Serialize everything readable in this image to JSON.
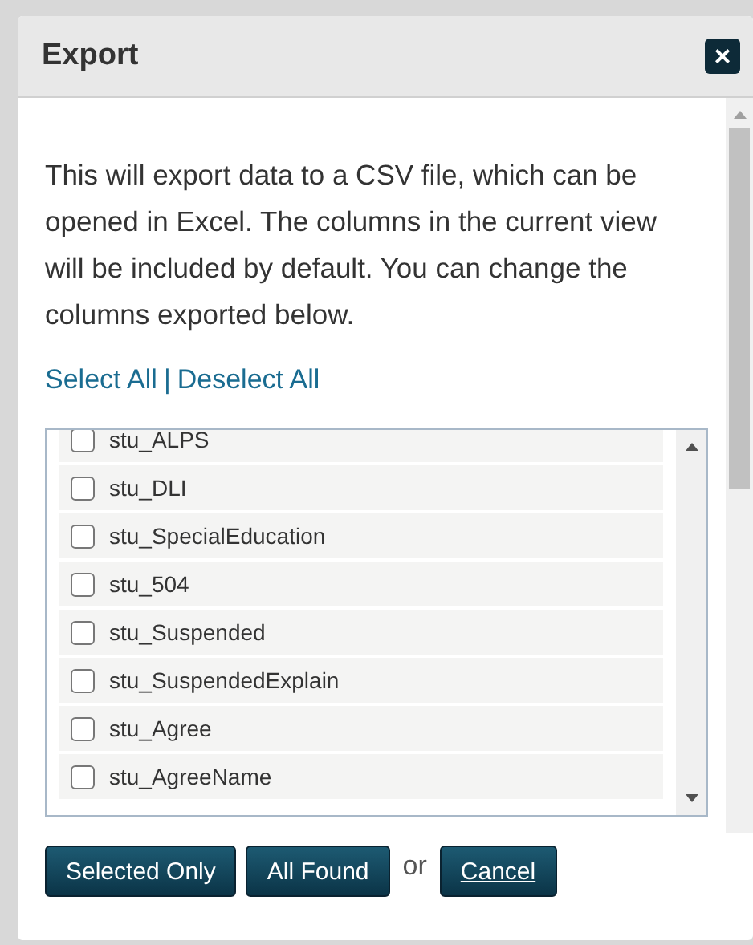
{
  "dialog": {
    "title": "Export",
    "close_label": "×"
  },
  "description": "This will export data to a CSV file, which can be opened in Excel. The columns in the current view will be included by default. You can change the columns exported below.",
  "links": [
    "Select All",
    "Deselect All"
  ],
  "link_separator": "|",
  "columns": [
    {
      "name": "stu_ALPS",
      "checked": false
    },
    {
      "name": "stu_DLI",
      "checked": false
    },
    {
      "name": "stu_SpecialEducation",
      "checked": false
    },
    {
      "name": "stu_504",
      "checked": false
    },
    {
      "name": "stu_Suspended",
      "checked": false
    },
    {
      "name": "stu_SuspendedExplain",
      "checked": false
    },
    {
      "name": "stu_Agree",
      "checked": false
    },
    {
      "name": "stu_AgreeName",
      "checked": false
    }
  ],
  "buttons": [
    {
      "label": "Selected Only",
      "kind": "primary"
    },
    {
      "label": "All Found",
      "kind": "primary"
    },
    {
      "label": "Cancel",
      "kind": "link"
    }
  ],
  "button_separator": "or"
}
